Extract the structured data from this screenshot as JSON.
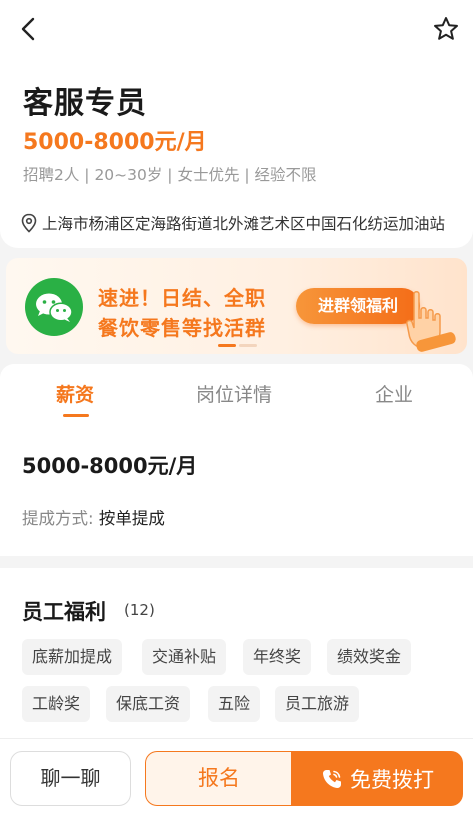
{
  "job": {
    "title": "客服专员",
    "salary": "5000-8000元/月",
    "requirements": "招聘2人 | 20~30岁 | 女士优先 | 经验不限",
    "address": "上海市杨浦区定海路街道北外滩艺术区中国石化纺运加油站"
  },
  "banner": {
    "line1": "速进！日结、全职",
    "line2": "餐饮零售等找活群",
    "button_label": "进群领福利",
    "logo_icon": "wechat-icon",
    "accent_color": "#f5781e"
  },
  "tabs": [
    {
      "label": "薪资",
      "active": true
    },
    {
      "label": "岗位详情",
      "active": false
    },
    {
      "label": "企业",
      "active": false
    }
  ],
  "salary_section": {
    "salary": "5000-8000元/月",
    "commission_label": "提成方式:",
    "commission_value": "按单提成"
  },
  "benefits": {
    "title": "员工福利",
    "count": "(12)",
    "tags": [
      "底薪加提成",
      "交通补贴",
      "年终奖",
      "绩效奖金",
      "工龄奖",
      "保底工资",
      "五险",
      "员工旅游"
    ]
  },
  "bottom_bar": {
    "chat_label": "聊一聊",
    "signup_label": "报名",
    "call_label": "免费拨打",
    "call_icon": "phone-icon"
  }
}
